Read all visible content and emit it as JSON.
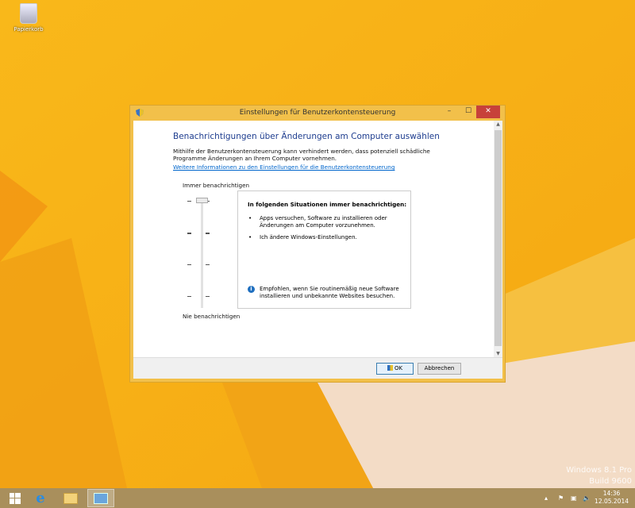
{
  "desktop": {
    "recycle_bin_label": "Papierkorb",
    "watermark_line1": "Windows 8.1 Pro",
    "watermark_line2": "Build 9600"
  },
  "dialog": {
    "title": "Einstellungen für Benutzerkontensteuerung",
    "heading": "Benachrichtigungen über Änderungen am Computer auswählen",
    "description": "Mithilfe der Benutzerkontensteuerung kann verhindert werden, dass potenziell schädliche Programme Änderungen an Ihrem Computer vornehmen.",
    "link": "Weitere Informationen zu den Einstellungen für die Benutzerkontensteuerung",
    "slider": {
      "top_label": "Immer benachrichtigen",
      "bottom_label": "Nie benachrichtigen",
      "level": 4,
      "levels": 4
    },
    "info": {
      "header": "In folgenden Situationen immer benachrichtigen:",
      "bullets": [
        "Apps versuchen, Software zu installieren oder Änderungen am Computer vorzunehmen.",
        "Ich ändere Windows-Einstellungen."
      ],
      "recommendation": "Empfohlen, wenn Sie routinemäßig neue Software installieren und unbekannte Websites besuchen."
    },
    "ok_label": "OK",
    "cancel_label": "Abbrechen"
  },
  "taskbar": {
    "time": "14:36",
    "date": "12.05.2014"
  }
}
